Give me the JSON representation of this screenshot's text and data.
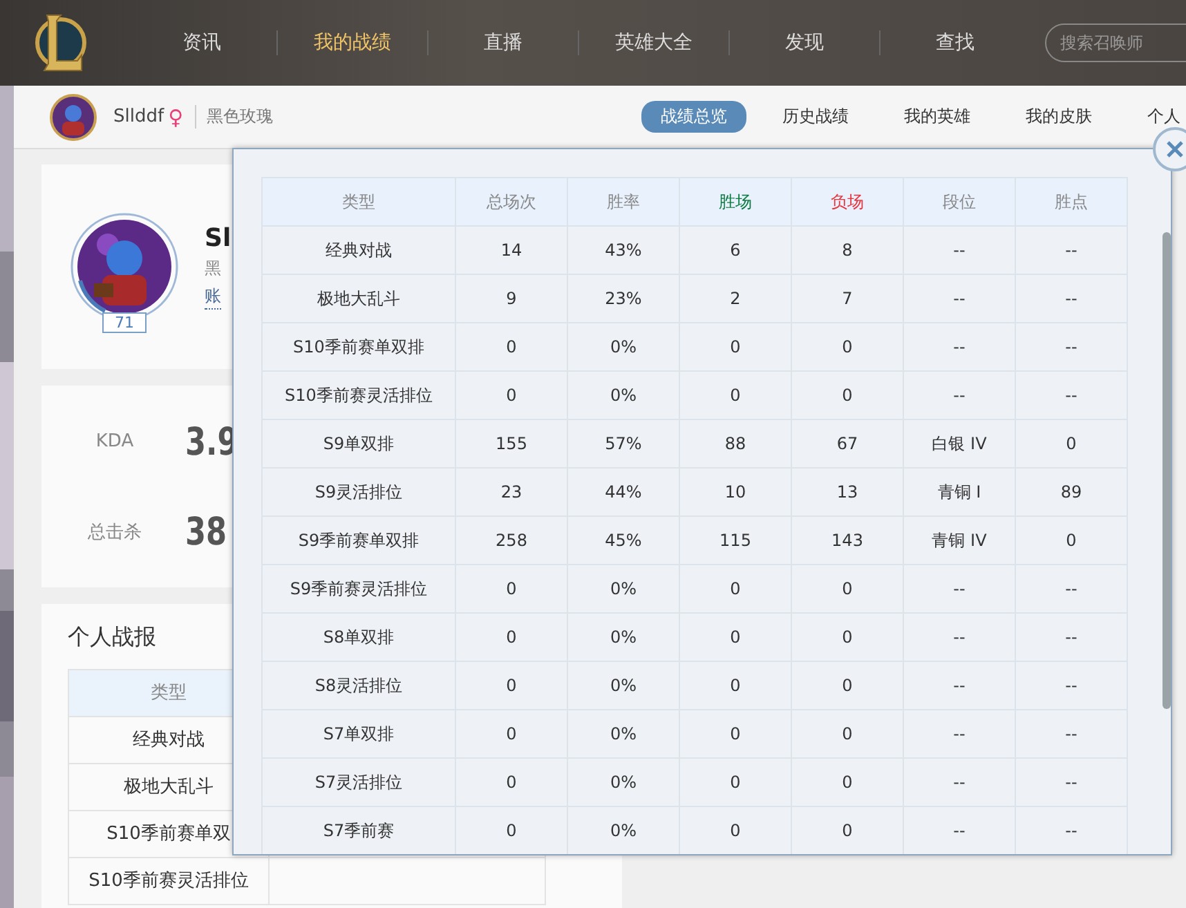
{
  "nav": {
    "items": [
      {
        "label": "资讯",
        "selected": false
      },
      {
        "label": "我的战绩",
        "selected": true
      },
      {
        "label": "直播",
        "selected": false
      },
      {
        "label": "英雄大全",
        "selected": false
      },
      {
        "label": "发现",
        "selected": false
      },
      {
        "label": "查找",
        "selected": false
      }
    ],
    "search": {
      "placeholder": "搜索召唤师"
    }
  },
  "profile_bar": {
    "name": "Sllddf",
    "gender": "♀",
    "server": "黑色玫瑰",
    "tabs": [
      {
        "label": "战绩总览",
        "selected": true
      },
      {
        "label": "历史战绩",
        "selected": false
      },
      {
        "label": "我的英雄",
        "selected": false
      },
      {
        "label": "我的皮肤",
        "selected": false
      },
      {
        "label": "个人",
        "selected": false
      }
    ]
  },
  "profile_card": {
    "level": "71",
    "name": "Sl",
    "line_1": "黑",
    "line_2": "账"
  },
  "stats": [
    {
      "label": "KDA",
      "value": "3.9"
    },
    {
      "label": "总击杀",
      "value": "38"
    }
  ],
  "report": {
    "title": "个人战报",
    "column": "类型",
    "rows": [
      "经典对战",
      "极地大乱斗",
      "S10季前赛单双",
      "S10季前赛灵活排位"
    ]
  },
  "modal": {
    "columns": [
      {
        "label": "类型",
        "color": "#888888"
      },
      {
        "label": "总场次",
        "color": "#888888"
      },
      {
        "label": "胜率",
        "color": "#888888"
      },
      {
        "label": "胜场",
        "color": "#0a7a3e"
      },
      {
        "label": "负场",
        "color": "#e8323c"
      },
      {
        "label": "段位",
        "color": "#888888"
      },
      {
        "label": "胜点",
        "color": "#888888"
      }
    ],
    "rows": [
      [
        "经典对战",
        "14",
        "43%",
        "6",
        "8",
        "--",
        "--"
      ],
      [
        "极地大乱斗",
        "9",
        "23%",
        "2",
        "7",
        "--",
        "--"
      ],
      [
        "S10季前赛单双排",
        "0",
        "0%",
        "0",
        "0",
        "--",
        "--"
      ],
      [
        "S10季前赛灵活排位",
        "0",
        "0%",
        "0",
        "0",
        "--",
        "--"
      ],
      [
        "S9单双排",
        "155",
        "57%",
        "88",
        "67",
        "白银 IV",
        "0"
      ],
      [
        "S9灵活排位",
        "23",
        "44%",
        "10",
        "13",
        "青铜 I",
        "89"
      ],
      [
        "S9季前赛单双排",
        "258",
        "45%",
        "115",
        "143",
        "青铜 IV",
        "0"
      ],
      [
        "S9季前赛灵活排位",
        "0",
        "0%",
        "0",
        "0",
        "--",
        "--"
      ],
      [
        "S8单双排",
        "0",
        "0%",
        "0",
        "0",
        "--",
        "--"
      ],
      [
        "S8灵活排位",
        "0",
        "0%",
        "0",
        "0",
        "--",
        "--"
      ],
      [
        "S7单双排",
        "0",
        "0%",
        "0",
        "0",
        "--",
        "--"
      ],
      [
        "S7灵活排位",
        "0",
        "0%",
        "0",
        "0",
        "--",
        "--"
      ],
      [
        "S7季前赛",
        "0",
        "0%",
        "0",
        "0",
        "--",
        "--"
      ]
    ]
  }
}
